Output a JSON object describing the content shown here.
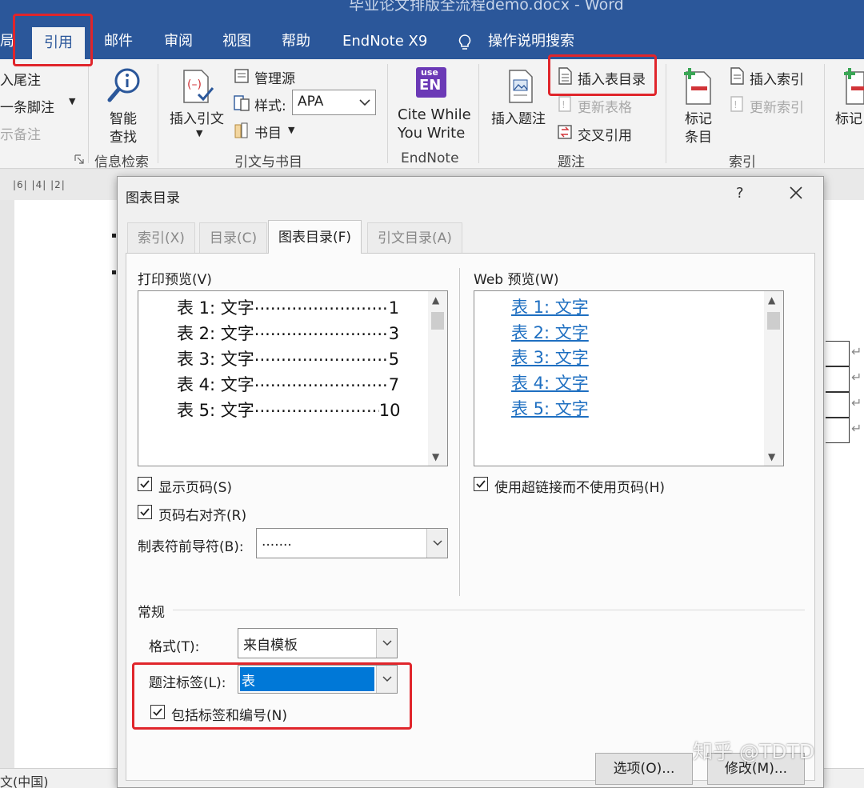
{
  "window": {
    "title": "毕业论文排版全流程demo.docx  -  Word"
  },
  "ribbon_tabs": [
    "局",
    "引用",
    "邮件",
    "审阅",
    "视图",
    "帮助",
    "EndNote X9",
    "操作说明搜索"
  ],
  "ribbon": {
    "footnotes": {
      "insert_endnote": "入尾注",
      "next_footnote": "一条脚注",
      "show_notes": "示备注"
    },
    "research": {
      "smart_lookup": [
        "智能",
        "查找"
      ],
      "group": "信息检索"
    },
    "citations": {
      "insert_citation": [
        "插入引文"
      ],
      "manage_sources": "管理源",
      "style_label": "样式:",
      "style_value": "APA",
      "bibliography": "书目",
      "group": "引文与书目"
    },
    "endnote": {
      "cite_while_you_write": [
        "Cite While",
        "You Write"
      ],
      "group": "EndNote",
      "logo_top": "use",
      "logo_bottom": "EN"
    },
    "captions": {
      "insert_caption": "插入题注",
      "insert_table_of_figures": "插入表目录",
      "update_table": "更新表格",
      "cross_reference": "交叉引用",
      "group": "题注"
    },
    "index": {
      "mark_entry": [
        "标记",
        "条目"
      ],
      "insert_index": "插入索引",
      "update_index": "更新索引",
      "group": "索引",
      "mark_cut": "标记"
    }
  },
  "ruler": {
    "numbers": "|6|  |4|  |2|"
  },
  "statusbar": {
    "language": "文(中国)"
  },
  "dialog": {
    "title": "图表目录",
    "help": "?",
    "tabs": [
      "索引(X)",
      "目录(C)",
      "图表目录(F)",
      "引文目录(A)"
    ],
    "print_preview": {
      "label": "打印预览(V)",
      "rows": [
        {
          "text": "表  1:  文字",
          "page": "1"
        },
        {
          "text": "表  2:  文字",
          "page": "3"
        },
        {
          "text": "表  3:  文字",
          "page": "5"
        },
        {
          "text": "表  4:  文字",
          "page": "7"
        },
        {
          "text": "表  5:  文字",
          "page": "10"
        }
      ]
    },
    "web_preview": {
      "label": "Web 预览(W)",
      "rows": [
        "表  1:  文字",
        "表  2:  文字",
        "表  3:  文字",
        "表  4:  文字",
        "表  5:  文字"
      ]
    },
    "show_page_numbers": {
      "label": "显示页码(S)",
      "checked": true
    },
    "right_align_page_numbers": {
      "label": "页码右对齐(R)",
      "checked": true
    },
    "use_hyperlinks": {
      "label": "使用超链接而不使用页码(H)",
      "checked": true
    },
    "tab_leader": {
      "label": "制表符前导符(B):",
      "value": "......."
    },
    "general": {
      "label": "常规",
      "format_label": "格式(T):",
      "format_value": "来自模板",
      "caption_label": "题注标签(L):",
      "caption_value": "表",
      "include_label": {
        "label": "包括标签和编号(N)",
        "checked": true
      }
    },
    "options_button": "选项(O)...",
    "modify_button": "修改(M)..."
  },
  "watermark": "知乎 @TDTD"
}
